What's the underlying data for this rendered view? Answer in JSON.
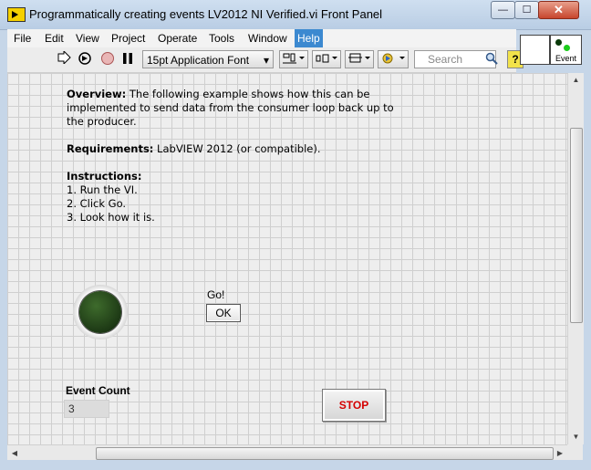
{
  "window": {
    "title": "Programmatically creating events LV2012 NI Verified.vi Front Panel",
    "min_symbol": "—",
    "max_symbol": "☐",
    "close_symbol": "✕"
  },
  "menu": {
    "items": [
      {
        "label": "File"
      },
      {
        "label": "Edit"
      },
      {
        "label": "View"
      },
      {
        "label": "Project"
      },
      {
        "label": "Operate"
      },
      {
        "label": "Tools"
      },
      {
        "label": "Window"
      },
      {
        "label": "Help",
        "active": true
      }
    ]
  },
  "toolbar": {
    "font_label": "15pt Application Font",
    "font_arrow": "▾",
    "search_placeholder": "Search",
    "help_label": "?",
    "icons": [
      "run-arrow-icon",
      "run-continuously-icon",
      "abort-icon",
      "pause-icon",
      "align-icon",
      "distribute-icon",
      "resize-icon",
      "reorder-icon"
    ]
  },
  "icon_pane": {
    "label": "Event"
  },
  "panel": {
    "overview_heading": "Overview:",
    "overview_text": " The following example shows how this can be implemented to send data from the consumer loop back up to the producer.",
    "requirements_heading": "Requirements:",
    "requirements_text": " LabVIEW 2012 (or compatible).",
    "instructions_heading": "Instructions:",
    "instructions": [
      "1. Run the VI.",
      "2. Click Go.",
      "3. Look how it is."
    ],
    "go_label": "Go!",
    "ok_label": "OK",
    "count_label": "Event Count",
    "count_value": "3",
    "stop_label": "STOP",
    "led_on": false
  },
  "colors": {
    "led_off": "#1d3915",
    "stop_text": "#d40000",
    "menu_active": "#3c89d0"
  }
}
